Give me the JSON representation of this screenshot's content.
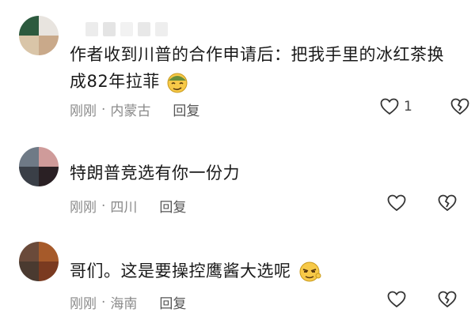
{
  "comments": [
    {
      "text_line1": "作者收到川普的合作申请后：把我手里的冰红茶换",
      "text_line2": "成82年拉菲",
      "time": "刚刚",
      "location": "内蒙古",
      "reply_label": "回复",
      "like_count": "1",
      "emoji": "smirk-emoji"
    },
    {
      "text_line1": "特朗普竞选有你一份力",
      "time": "刚刚",
      "location": "四川",
      "reply_label": "回复"
    },
    {
      "text_line1": "哥们。这是要操控鹰酱大选呢",
      "time": "刚刚",
      "location": "海南",
      "reply_label": "回复",
      "emoji": "sly-emoji"
    }
  ],
  "separator": "·",
  "colors": {
    "icon": "#333333",
    "meta": "#8a8a8a",
    "text": "#1a1a1a"
  }
}
